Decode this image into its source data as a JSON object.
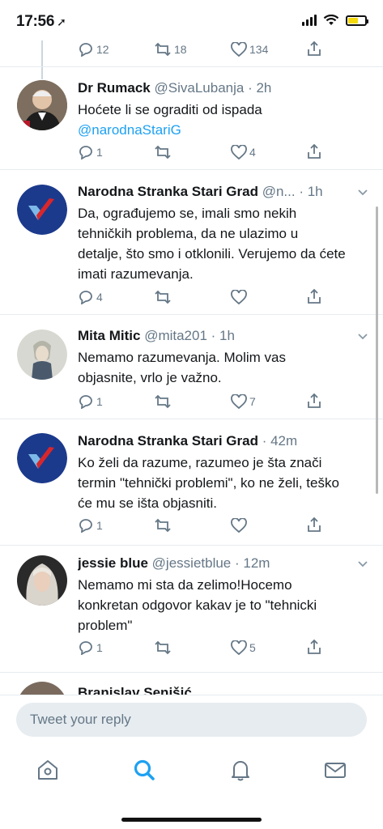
{
  "status_bar": {
    "time": "17:56"
  },
  "top_actions": {
    "replies": "12",
    "retweets": "18",
    "likes": "134"
  },
  "tweets": [
    {
      "name": "Dr Rumack",
      "handle": "@SivaLubanja",
      "time": "· 2h",
      "text": "Hoćete li se ograditi od ispada",
      "mention": "@narodnaStariG",
      "replies": "1",
      "retweets": "",
      "likes": "4"
    },
    {
      "name": "Narodna Stranka Stari Grad",
      "handle": "@n...",
      "time": "· 1h",
      "text": "Da, ograđujemo se, imali smo nekih tehničkih problema, da ne ulazimo u detalje, što smo i otklonili. Verujemo da ćete imati razumevanja.",
      "replies": "4",
      "retweets": "",
      "likes": ""
    },
    {
      "name": "Mita Mitic",
      "handle": "@mita201",
      "time": "· 1h",
      "text": "Nemamo razumevanja. Molim vas objasnite, vrlo je važno.",
      "replies": "1",
      "retweets": "",
      "likes": "7"
    },
    {
      "name": "Narodna Stranka Stari Grad",
      "handle": "",
      "time": "· 42m",
      "text": "Ko želi da razume, razumeo je šta znači termin \"tehnički problemi\", ko ne želi, teško će mu se išta objasniti.",
      "replies": "1",
      "retweets": "",
      "likes": ""
    },
    {
      "name": "jessie blue",
      "handle": "@jessietblue",
      "time": "· 12m",
      "text": "Nemamo mi sta da zelimo!Hocemo konkretan odgovor kakav je to \"tehnicki problem\"",
      "replies": "1",
      "retweets": "",
      "likes": "5"
    }
  ],
  "partial_tweet_name": "Branislav Senišić",
  "reply_bar": {
    "placeholder": "Tweet your reply"
  },
  "colors": {
    "accent": "#1da1f2",
    "muted": "#657786",
    "logo_navy": "#1c3a8c",
    "logo_red": "#d9262b"
  },
  "icons": [
    "home-icon",
    "search-icon",
    "bell-icon",
    "mail-icon",
    "reply-icon",
    "retweet-icon",
    "like-icon",
    "share-icon",
    "chevron-down-icon"
  ]
}
